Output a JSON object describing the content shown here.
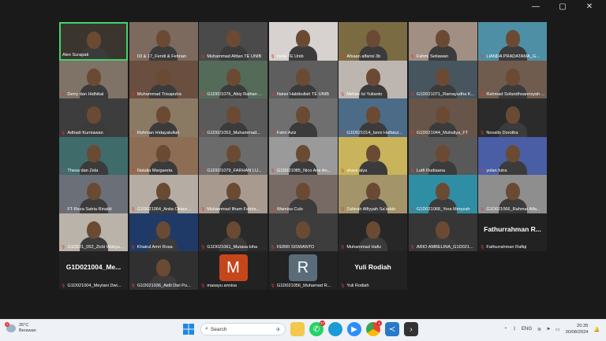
{
  "window_controls": {
    "minimize": "—",
    "maximize": "▢",
    "close": "✕"
  },
  "participants": [
    {
      "name": "Alex Surapati",
      "active": true,
      "bg": "#3b3530"
    },
    {
      "name": "03 & 17_Fendi & Febrian",
      "bg": "#7d6a5e"
    },
    {
      "name": "Muhammad Afdan TE UNIB",
      "bg": "#4a4a4a"
    },
    {
      "name": "mela TE Unib",
      "bg": "#d7d2cf"
    },
    {
      "name": "Afsaan alfarisi 3b",
      "bg": "#7b6b43"
    },
    {
      "name": "Fahmi Setiawan",
      "bg": "#a08f82"
    },
    {
      "name": "LIANDA PRADATAMA_G...",
      "bg": "#4e8fa6"
    },
    {
      "name": "Derry dan Hidhikal",
      "bg": "#7f7266"
    },
    {
      "name": "Muhammad Trisaputra",
      "bg": "#6a4e40"
    },
    {
      "name": "G1D021076_Abiy Raihan ...",
      "bg": "#556b5a"
    },
    {
      "name": "Natsir Habibullah TE UNIB",
      "bg": "#5e5e5e"
    },
    {
      "name": "Melian Isi Yulianto",
      "bg": "#bdb6b0"
    },
    {
      "name": "G1D021071_Ramayudha K...",
      "bg": "#47555f"
    },
    {
      "name": "Rahmad Sofandhoannsyah ...",
      "bg": "#705c4f"
    },
    {
      "name": "Adhadi Kurniawan",
      "bg": "#3d3d3d"
    },
    {
      "name": "Rohman Hidayatullah",
      "bg": "#8a7963"
    },
    {
      "name": "G1D021053_Muhammad...",
      "bg": "#5a5a5a"
    },
    {
      "name": "Fahri Aziz",
      "bg": "#6f6f6f"
    },
    {
      "name": "G1D021014_Isnni Haflatul...",
      "bg": "#4c6b86"
    },
    {
      "name": "G1D021044_Muhsliya_FT",
      "bg": "#675549"
    },
    {
      "name": "Novallo Dorotha",
      "bg": "#2b2b2b"
    },
    {
      "name": "Thesa dan Zela",
      "bg": "#3f6b6b"
    },
    {
      "name": "Natalia Margareta",
      "bg": "#8d6e55"
    },
    {
      "name": "G1D021079_FARHAN LU...",
      "bg": "#6b6b6b"
    },
    {
      "name": "G1D021085_Nico Arie An...",
      "bg": "#9a9a9a"
    },
    {
      "name": "shara alya",
      "bg": "#c9b35b"
    },
    {
      "name": "Lutfi Rudiaana",
      "bg": "#595959"
    },
    {
      "name": "yolan futra",
      "bg": "#4a5ea6"
    },
    {
      "name": "FT-Reza Satria Rinaldi",
      "bg": "#6a6f78"
    },
    {
      "name": "G1D021064_Anita Oktavi...",
      "bg": "#b5aca4"
    },
    {
      "name": "Muhammad Ilham Febria...",
      "bg": "#a89a8e"
    },
    {
      "name": "Wamisa Culo",
      "bg": "#776a64"
    },
    {
      "name": "Zahirah Alfiyyah Sa'adah",
      "bg": "#a39469"
    },
    {
      "name": "G1D021068_Yora Meryzah",
      "bg": "#2f8ea3"
    },
    {
      "name": "G1D021066_Rahmat Alfa...",
      "bg": "#8e8e8e"
    },
    {
      "name": "G1D021_052_Zicki Wahyu...",
      "bg": "#bab3a9"
    },
    {
      "name": "Khairul Amri Rosa",
      "bg": "#1f3a66"
    },
    {
      "name": "G1D021061_Mutasa biha",
      "bg": "#2a2a2a"
    },
    {
      "name": "FEBRI SISWANTO",
      "bg": "#3d3d3d"
    },
    {
      "name": "Muhammad Hafiz",
      "bg": "#272727"
    },
    {
      "name": "ARIO AMBELINA_G1D021...",
      "bg": "#363636"
    },
    {
      "name": "Fathurrahman Rafiqi",
      "big": "Fathurrahman  R...",
      "bg": "#222"
    },
    {
      "name": "G1D021004_Meylani Dwi...",
      "big": "G1D021004_Me...",
      "bg": "#222"
    },
    {
      "name": "G1D021036_Aidil Dwi Pu...",
      "bg": "#303030"
    },
    {
      "name": "masayu annisa",
      "avatar": "M",
      "avatar_color": "#c5461b",
      "bg": "#222"
    },
    {
      "name": "G1D021056_Muhamad R...",
      "avatar": "R",
      "avatar_color": "#5a6c7a",
      "bg": "#222"
    },
    {
      "name": "Yuli Rodiah",
      "big": "Yuli Rodiah",
      "bg": "#222"
    }
  ],
  "taskbar": {
    "weather_temp": "26°C",
    "weather_desc": "Berawan",
    "weather_badge": "1",
    "search_placeholder": "Search",
    "whatsapp_badge": "27",
    "chrome_badge": "4",
    "lang": "ENG",
    "time": "20.35",
    "date": "30/08/2024"
  }
}
